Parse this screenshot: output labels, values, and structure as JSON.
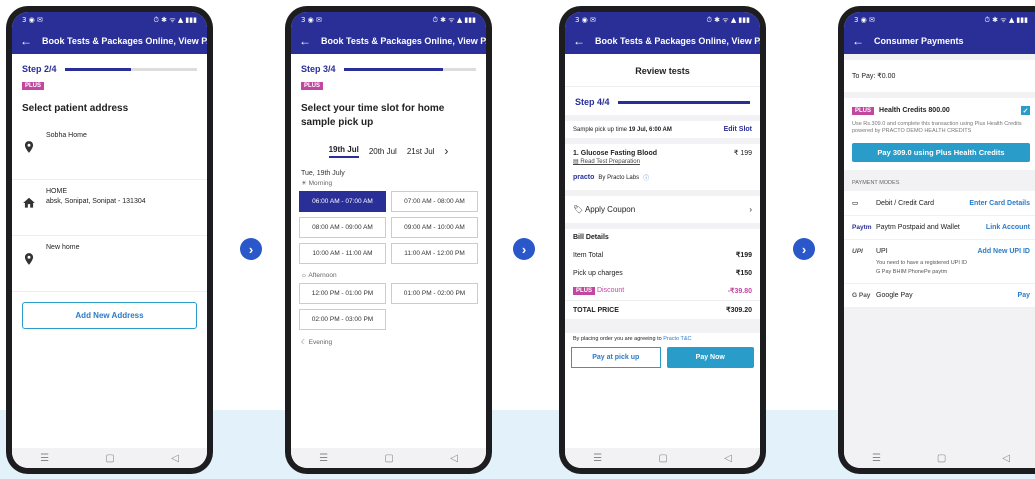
{
  "common": {
    "status_left": "3 ◉ ✉",
    "status_right": "⏱ ✱ ᯤ ▲ ▮▮▮",
    "nav_menu": "☰",
    "nav_home": "▢",
    "nav_back": "◁",
    "next_arrow": "›",
    "back_arrow": "←",
    "plus_badge": "PLUS"
  },
  "screen1": {
    "title": "Book Tests & Packages Online, View P...",
    "step": "Step 2/4",
    "step_progress": 0.5,
    "heading": "Select patient address",
    "addresses": [
      {
        "name": "Sobha Home",
        "line": "",
        "icon": "location-pin-icon"
      },
      {
        "name": "HOME",
        "line": "absk, Sonipat, Sonipat - 131304",
        "icon": "home-icon"
      },
      {
        "name": "New home",
        "line": "",
        "icon": "location-pin-icon"
      }
    ],
    "add_button": "Add New Address"
  },
  "screen2": {
    "title": "Book Tests & Packages Online, View P...",
    "step": "Step 3/4",
    "step_progress": 0.75,
    "heading": "Select your time slot for home sample pick up",
    "dates": [
      "19th Jul",
      "20th Jul",
      "21st Jul"
    ],
    "day_label": "Tue, 19th July",
    "morning_label": "Morning",
    "morning_slots": [
      "06:00 AM - 07:00 AM",
      "07:00 AM - 08:00 AM",
      "08:00 AM - 09:00 AM",
      "09:00 AM - 10:00 AM",
      "10:00 AM - 11:00 AM",
      "11:00 AM - 12:00 PM"
    ],
    "afternoon_label": "Afternoon",
    "afternoon_slots": [
      "12:00 PM - 01:00 PM",
      "01:00 PM - 02:00 PM",
      "02:00 PM - 03:00 PM"
    ],
    "evening_label": "Evening"
  },
  "screen3": {
    "title": "Book Tests & Packages Online, View P...",
    "header": "Review tests",
    "step": "Step 4/4",
    "step_progress": 1.0,
    "pickup_prefix": "Sample pick up time",
    "pickup_time": "19 Jul, 6:00 AM",
    "edit_slot": "Edit Slot",
    "test_name": "1. Glucose Fasting Blood",
    "test_price": "₹ 199",
    "read_prep": "Read Test Preparation",
    "lab_logo": "practo",
    "lab_name": "By Practo Labs",
    "coupon": "Apply Coupon",
    "bill_title": "Bill Details",
    "item_total_label": "Item Total",
    "item_total": "₹199",
    "pickup_charges_label": "Pick up charges",
    "pickup_charges": "₹150",
    "discount_label": "Discount",
    "discount": "-₹39.80",
    "total_label": "TOTAL PRICE",
    "total": "₹309.20",
    "terms_text": "By placing order you are agreeing to",
    "terms_link": "Practo T&C",
    "pay_pickup": "Pay at pick up",
    "pay_now": "Pay Now"
  },
  "screen4": {
    "title": "Consumer Payments",
    "to_pay": "To Pay: ₹0.00",
    "health_credits": "Health Credits 800.00",
    "credits_note": "Use Rs.309.0 and complete this transaction using Plus Health Credits powered by PRACTO DEMO HEALTH CREDITS",
    "pay_button": "Pay 309.0 using Plus Health Credits",
    "modes_label": "PAYMENT MODES",
    "modes": [
      {
        "icon": "▭",
        "name": "Debit / Credit Card",
        "action": "Enter Card Details"
      },
      {
        "icon": "Paytm",
        "name": "Paytm Postpaid and Wallet",
        "action": "Link Account"
      },
      {
        "icon": "UPI",
        "name": "UPI",
        "action": "Add New UPI ID"
      },
      {
        "icon": "G Pay",
        "name": "Google Pay",
        "action": "Pay"
      }
    ],
    "upi_note": "You need to have a registered UPI ID",
    "upi_apps": "G Pay  BHIM  PhonePe  paytm"
  }
}
